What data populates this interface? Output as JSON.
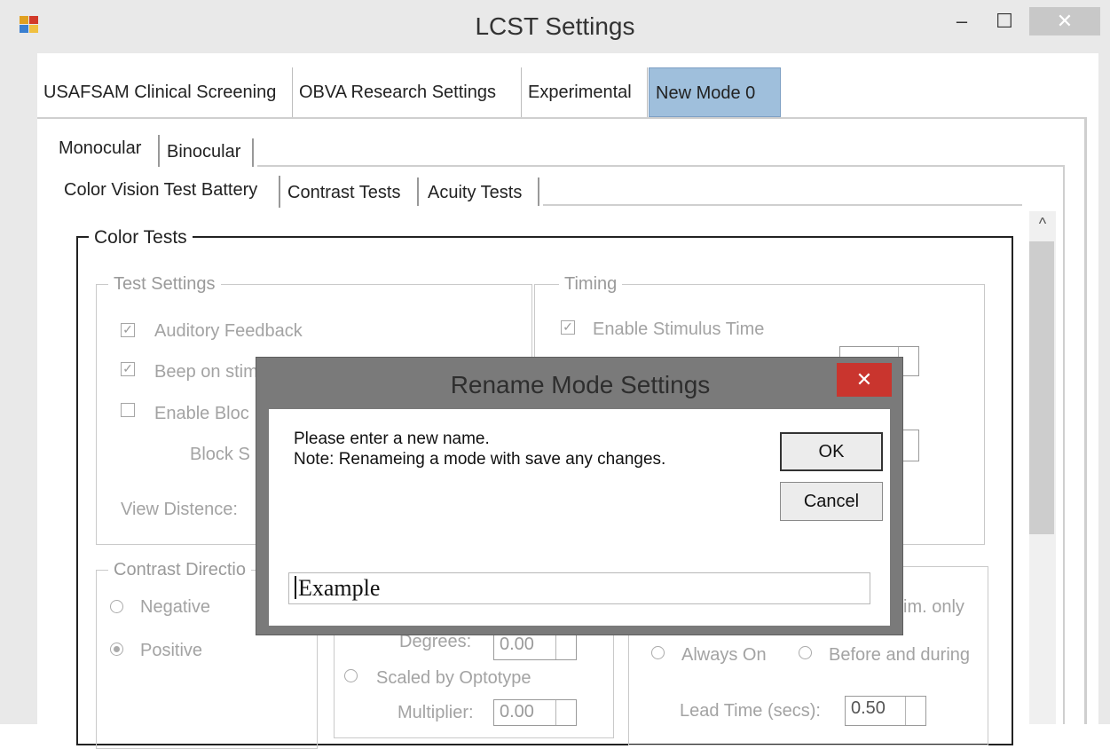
{
  "window": {
    "title": "LCST Settings",
    "minimize": "–",
    "maximize": "☐",
    "close": "✕"
  },
  "mode_tabs": [
    {
      "label": "USAFSAM Clinical Screening"
    },
    {
      "label": "OBVA Research Settings"
    },
    {
      "label": "Experimental"
    },
    {
      "label": "New Mode 0",
      "selected": true
    }
  ],
  "eye_tabs": [
    {
      "label": "Monocular",
      "selected": true
    },
    {
      "label": "Binocular"
    }
  ],
  "test_tabs": [
    {
      "label": "Color Vision Test Battery",
      "selected": true
    },
    {
      "label": "Contrast Tests"
    },
    {
      "label": "Acuity Tests"
    }
  ],
  "color_tests": {
    "legend": "Color Tests",
    "test_settings": {
      "legend": "Test Settings",
      "auditory_feedback": "Auditory Feedback",
      "beep_on_stim": "Beep on stim",
      "enable_block": "Enable Bloc",
      "block_size": "Block S",
      "view_distance": "View Distence:"
    },
    "timing": {
      "legend": "Timing",
      "enable_stimulus_time": "Enable Stimulus Time"
    },
    "contrast_direction": {
      "legend": "Contrast Directio",
      "negative": "Negative",
      "positive": "Positive"
    },
    "size": {
      "degrees_label": "Degrees:",
      "degrees_value": "0.00",
      "scaled_by_optotype": "Scaled by Optotype",
      "multiplier_label": "Multiplier:",
      "multiplier_value": "0.00"
    },
    "fixation": {
      "stim_only": "im. only",
      "always_on": "Always On",
      "before_and_during": "Before and during",
      "lead_time_label": "Lead Time (secs):",
      "lead_time_value": "0.50"
    }
  },
  "dialog": {
    "title": "Rename Mode Settings",
    "close": "✕",
    "message_line1": "Please enter a new name.",
    "message_line2": "Note: Renameing a mode with save any changes.",
    "ok": "OK",
    "cancel": "Cancel",
    "input_value": "Example"
  },
  "scrollbar": {
    "up_arrow": "^"
  }
}
